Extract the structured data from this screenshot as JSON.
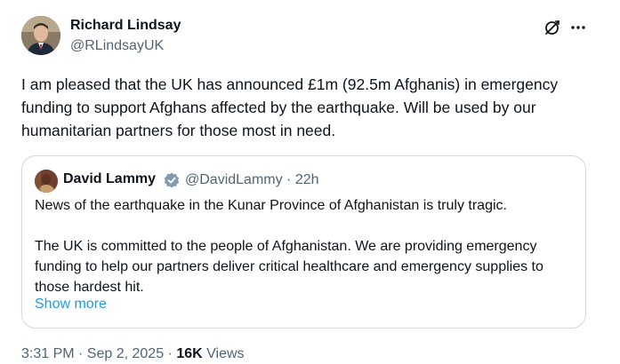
{
  "author": {
    "name": "Richard Lindsay",
    "handle": "@RLindsayUK"
  },
  "tweet": {
    "text": "I am pleased that the UK has announced £1m (92.5m Afghanis) in emergency funding to support Afghans affected by the earthquake.  Will be used by our humanitarian partners for those most in need."
  },
  "icons": {
    "grok": "grok-icon",
    "more": "more-icon",
    "verified": "verified-badge-icon"
  },
  "colors": {
    "accent": "#1d9bf0",
    "text": "#0f1419",
    "secondary": "#536471",
    "border": "#cfd9de"
  },
  "quote": {
    "name": "David Lammy",
    "handle_time": "@DavidLammy · 22h",
    "paragraph1": "News of the earthquake in the Kunar Province of Afghanistan is truly tragic.",
    "paragraph2": "The UK is committed to the people of Afghanistan. We are providing emergency funding to help our partners deliver critical healthcare and emergency supplies to those hardest hit.",
    "show_more": "Show more"
  },
  "meta": {
    "timestamp": "3:31 PM · Sep 2, 2025 · ",
    "views_count": "16K",
    "views_label": " Views"
  }
}
